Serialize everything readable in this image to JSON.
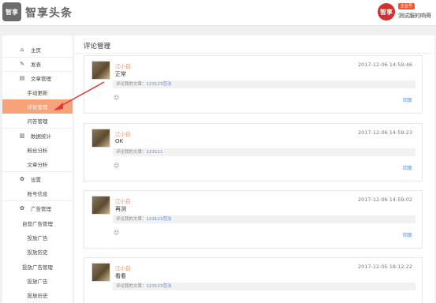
{
  "header": {
    "logo_mark": "智享",
    "logo_text": "智享头条",
    "avatar_mark": "智享",
    "badge": "企业号",
    "user_name": "测试服的响哥"
  },
  "sidebar": {
    "items": [
      {
        "label": "主页",
        "icon": "home-icon",
        "level": "top"
      },
      {
        "label": "发表",
        "icon": "edit-icon",
        "level": "top"
      },
      {
        "label": "文章管理",
        "icon": "document-icon",
        "level": "top"
      },
      {
        "label": "手动更新",
        "level": "sub"
      },
      {
        "label": "评论管理",
        "level": "sub",
        "active": true
      },
      {
        "label": "问答管理",
        "level": "sub"
      },
      {
        "label": "数据统计",
        "icon": "bar-chart-icon",
        "level": "top"
      },
      {
        "label": "粉丝分析",
        "level": "sub"
      },
      {
        "label": "文章分析",
        "level": "sub"
      },
      {
        "label": "设置",
        "icon": "gear-icon",
        "level": "top"
      },
      {
        "label": "账号信息",
        "level": "sub"
      },
      {
        "label": "广告管理",
        "icon": "gear-icon",
        "level": "top"
      },
      {
        "label": "自营广告管理",
        "level": "sub"
      },
      {
        "label": "投放广告",
        "level": "sub"
      },
      {
        "label": "投放历史",
        "level": "sub"
      },
      {
        "label": "投放广告管理",
        "level": "sub"
      },
      {
        "label": "投放广告",
        "level": "sub"
      },
      {
        "label": "投放历史",
        "level": "sub"
      }
    ]
  },
  "main": {
    "title": "评论管理",
    "comments": [
      {
        "user": "江小白",
        "time": "2017-12-06 14:59:46",
        "content": "正常",
        "ref_prefix": "评论我的文章：",
        "ref_title": "123123范法",
        "reply": "回复"
      },
      {
        "user": "江小白",
        "time": "2017-12-06 14:59:23",
        "content": "OK",
        "ref_prefix": "评论我的文章：",
        "ref_title": "123111",
        "reply": "回复"
      },
      {
        "user": "江小白",
        "time": "2017-12-06 14:59:02",
        "content": "再测",
        "ref_prefix": "评论我的文章：",
        "ref_title": "123123范法",
        "reply": "回复"
      },
      {
        "user": "江小白",
        "time": "2017-12-05 18:12:22",
        "content": "看看",
        "ref_prefix": "评论我的文章：",
        "ref_title": "123123范法",
        "reply": "回复"
      }
    ]
  },
  "colors": {
    "accent": "#f8a27a",
    "link": "#5a8ed8",
    "brand_red": "#d32f2f",
    "annotation": "#e53935"
  }
}
